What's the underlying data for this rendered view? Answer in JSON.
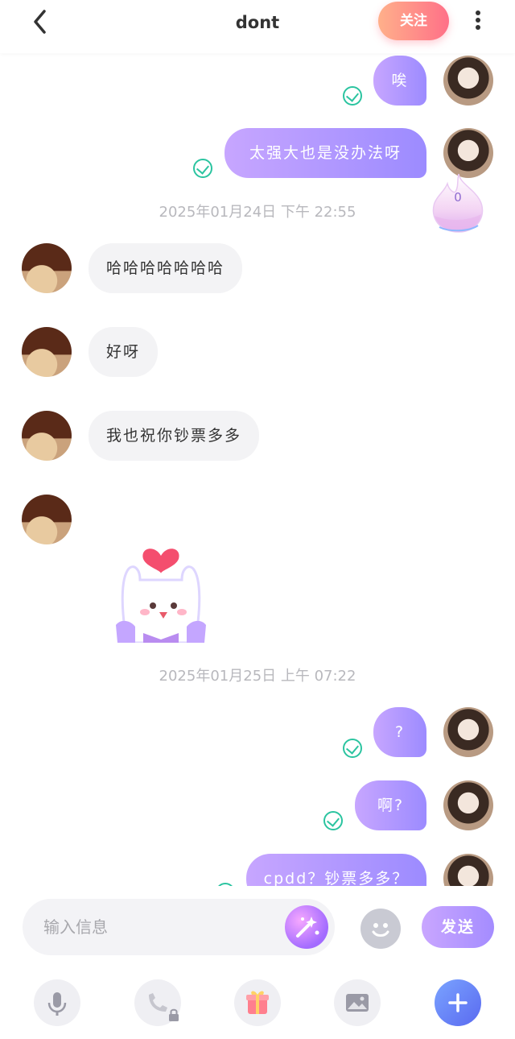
{
  "header": {
    "title": "dont",
    "follow_label": "关注",
    "back_icon": "chevron-left-icon",
    "more_icon": "more-vertical-icon"
  },
  "messages": {
    "out_1": "唉",
    "out_2": "太强大也是没办法呀",
    "timestamp_1": "2025年01月24日 下午 22:55",
    "in_1": "哈哈哈哈哈哈哈",
    "in_2": "好呀",
    "in_3": "我也祝你钞票多多",
    "timestamp_2": "2025年01月25日 上午 07:22",
    "out_3": "?",
    "out_4": "啊?",
    "out_5": "cpdd？钞票多多？"
  },
  "flame": {
    "count": "0"
  },
  "input": {
    "placeholder": "输入信息",
    "send_label": "发送"
  },
  "toolbar": {
    "icons": [
      "microphone-icon",
      "phone-locked-icon",
      "gift-icon",
      "image-icon",
      "plus-icon"
    ]
  },
  "colors": {
    "accent_purple": "#a48cff",
    "follow_pink": "#ff7088",
    "read_check": "#2bc4a0"
  }
}
